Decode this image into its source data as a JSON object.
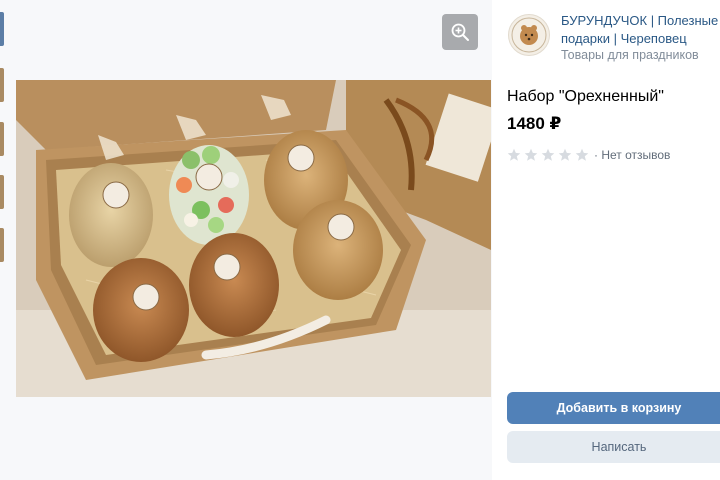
{
  "shop": {
    "name": "БУРУНДУЧОК | Полезные подарки | Череповец",
    "category": "Товары для праздников",
    "avatar_icon": "chipmunk-logo"
  },
  "product": {
    "title": "Набор \"Орехненный\"",
    "price": "1480 ₽",
    "rating_stars": 0,
    "reviews_text": "· Нет отзывов"
  },
  "actions": {
    "add_to_cart": "Добавить в корзину",
    "write": "Написать"
  },
  "photo": {
    "alt": "gift box with nuts",
    "zoom_icon": "zoom-in-icon"
  },
  "thumbnails_count": 5,
  "colors": {
    "accent": "#5181b8",
    "link": "#2a5885",
    "secondary_button": "#e5ebf1"
  }
}
